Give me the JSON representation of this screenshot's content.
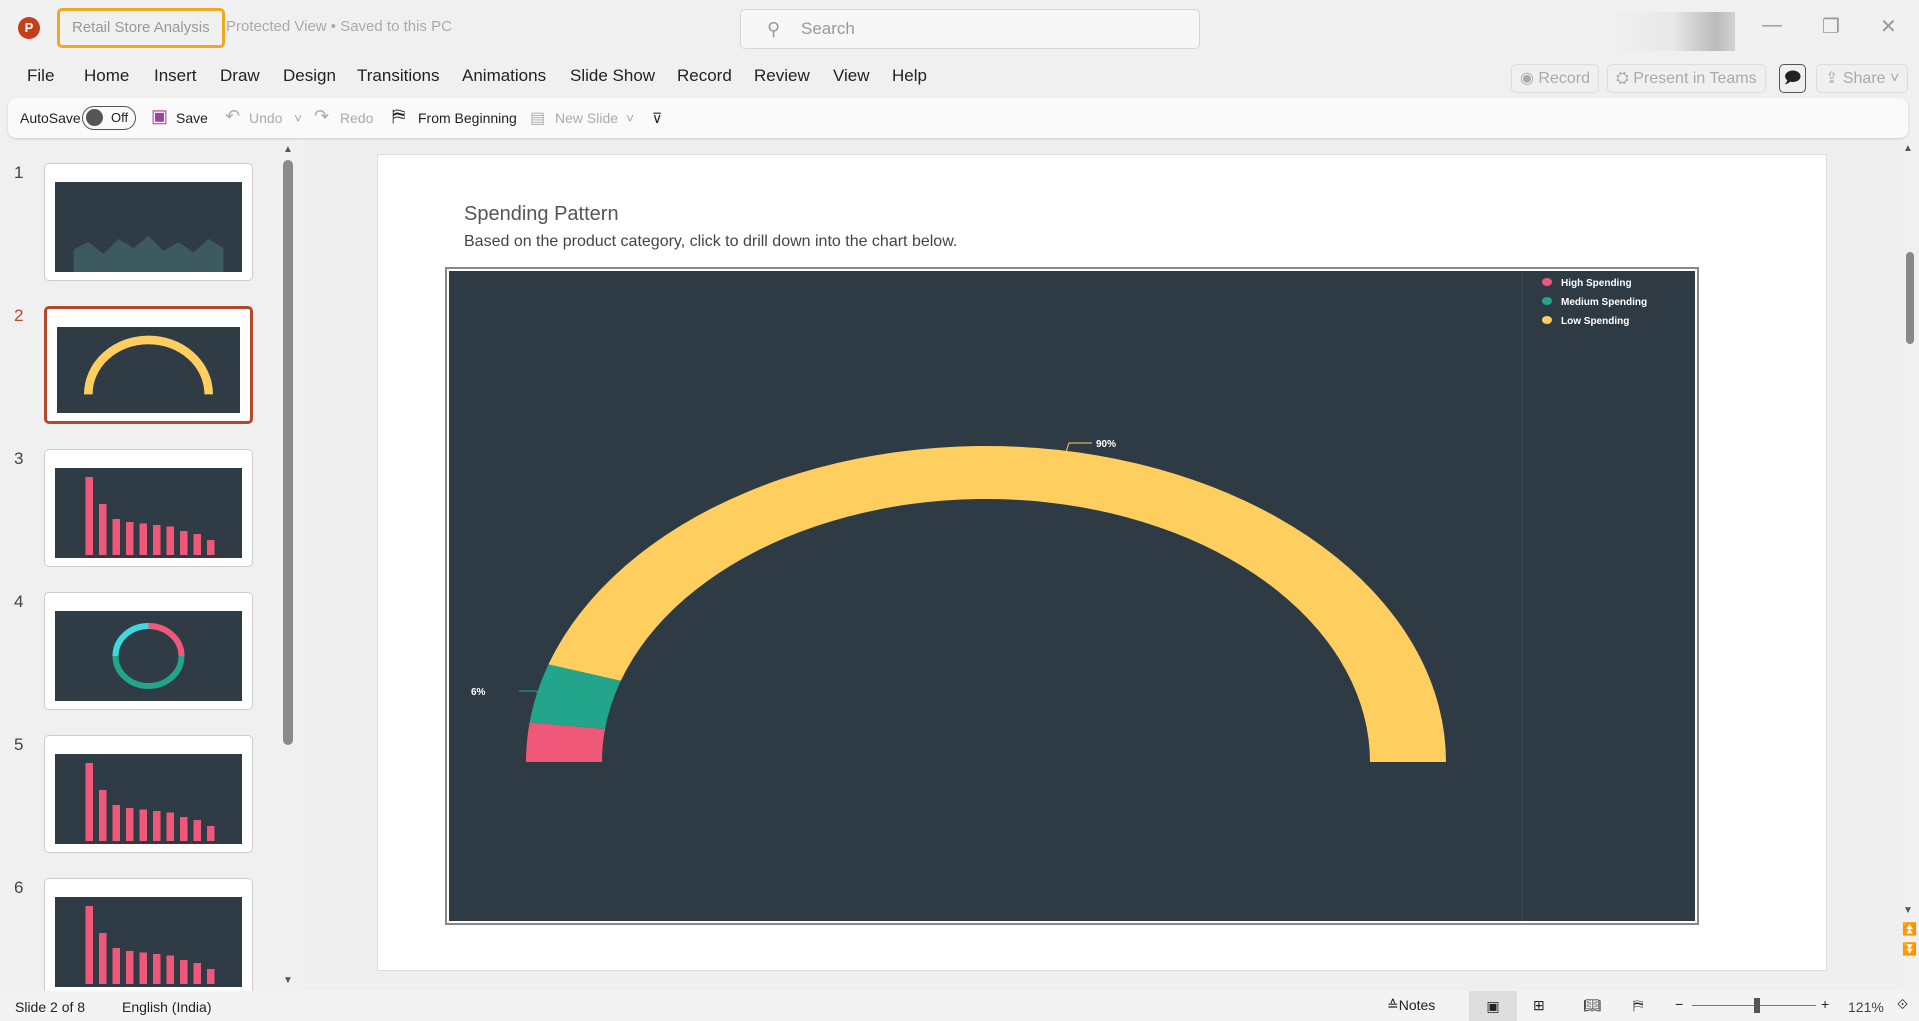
{
  "titlebar": {
    "doc_name": "Retail Store Analysis",
    "status": "Protected View • Saved to this PC",
    "search_placeholder": "Search",
    "app_icon": "P"
  },
  "menu": [
    "File",
    "Home",
    "Insert",
    "Draw",
    "Design",
    "Transitions",
    "Animations",
    "Slide Show",
    "Record",
    "Review",
    "View",
    "Help"
  ],
  "ribbon_right": {
    "record": "Record",
    "present": "Present in Teams",
    "share": "Share"
  },
  "toolbar": {
    "autosave": "AutoSave",
    "toggle": "Off",
    "save": "Save",
    "undo": "Undo",
    "redo": "Redo",
    "from_beginning": "From Beginning",
    "new_slide": "New Slide"
  },
  "thumbnails": [
    "1",
    "2",
    "3",
    "4",
    "5",
    "6"
  ],
  "slide": {
    "title": "Spending Pattern",
    "subtitle": "Based on the product category, click to drill down into the chart below."
  },
  "chart_data": {
    "type": "pie",
    "variant": "semi-donut",
    "series": [
      {
        "name": "High Spending",
        "value": 4,
        "color": "#f0587a"
      },
      {
        "name": "Medium Spending",
        "value": 6,
        "color": "#22a58a"
      },
      {
        "name": "Low Spending",
        "value": 90,
        "color": "#fecf5f"
      }
    ],
    "data_labels": {
      "medium": "6%",
      "low": "90%"
    },
    "legend_position": "top-right"
  },
  "statusbar": {
    "slide": "Slide 2 of 8",
    "language": "English (India)",
    "notes": "Notes",
    "zoom": "121%"
  }
}
